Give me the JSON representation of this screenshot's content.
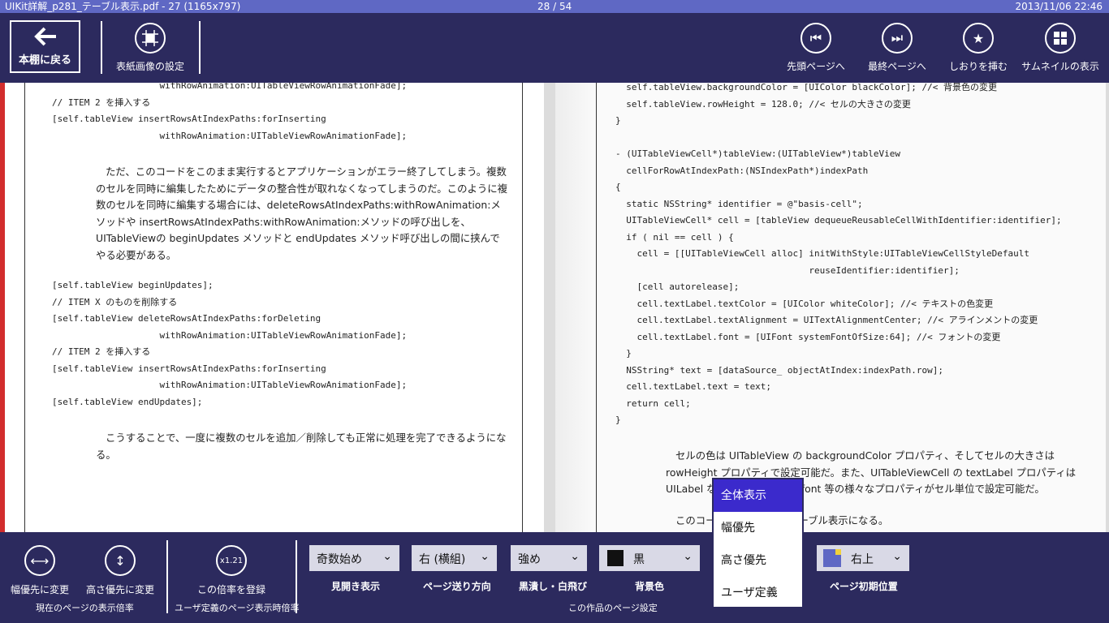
{
  "title_bar": {
    "file_title": "UIKit詳解_p281_テーブル表示.pdf - 27 (1165x797)",
    "page_counter": "28 / 54",
    "datetime": "2013/11/06 22:46"
  },
  "top_bar": {
    "back_label": "本棚に戻る",
    "cover_label": "表紙画像の設定",
    "first_page_label": "先頭ページへ",
    "last_page_label": "最終ページへ",
    "bookmark_label": "しおりを挿む",
    "thumbnail_label": "サムネイルの表示"
  },
  "left_page": {
    "code1": "                    withRowAnimation:UITableViewRowAnimationFade];\n// ITEM 2 を挿入する\n[self.tableView insertRowsAtIndexPaths:forInserting\n                    withRowAnimation:UITableViewRowAnimationFade];",
    "para1": "ただ、このコードをこのまま実行するとアプリケーションがエラー終了してしまう。複数のセルを同時に編集したためにデータの整合性が取れなくなってしまうのだ。このように複数のセルを同時に編集する場合には、deleteRowsAtIndexPaths:withRowAnimation:メソッドや insertRowsAtIndexPaths:withRowAnimation:メソッドの呼び出しを、UITableViewの beginUpdates メソッドと endUpdates メソッド呼び出しの間に挟んでやる必要がある。",
    "code2": "[self.tableView beginUpdates];\n// ITEM X のものを削除する\n[self.tableView deleteRowsAtIndexPaths:forDeleting\n                    withRowAnimation:UITableViewRowAnimationFade];\n// ITEM 2 を挿入する\n[self.tableView insertRowsAtIndexPaths:forInserting\n                    withRowAnimation:UITableViewRowAnimationFade];\n[self.tableView endUpdates];",
    "para2": "こうすることで、一度に複数のセルを追加／削除しても正常に処理を完了できるようになる。"
  },
  "right_page": {
    "code": "  self.tableView.backgroundColor = [UIColor blackColor]; //< 背景色の変更\n  self.tableView.rowHeight = 128.0; //< セルの大きさの変更\n}\n\n- (UITableViewCell*)tableView:(UITableView*)tableView\n  cellForRowAtIndexPath:(NSIndexPath*)indexPath\n{\n  static NSString* identifier = @\"basis-cell\";\n  UITableViewCell* cell = [tableView dequeueReusableCellWithIdentifier:identifier];\n  if ( nil == cell ) {\n    cell = [[UITableViewCell alloc] initWithStyle:UITableViewCellStyleDefault\n                                    reuseIdentifier:identifier];\n    [cell autorelease];\n    cell.textLabel.textColor = [UIColor whiteColor]; //< テキストの色変更\n    cell.textLabel.textAlignment = UITextAlignmentCenter; //< アラインメントの変更\n    cell.textLabel.font = [UIFont systemFontOfSize:64]; //< フォントの変更\n  }\n  NSString* text = [dataSource_ objectAtIndex:indexPath.row];\n  cell.textLabel.text = text;\n  return cell;\n}",
    "para1": "セルの色は UITableView の backgroundColor プロパティ、そしてセルの大きさは rowHeight プロパティで設定可能だ。また、UITableViewCell の textLabel プロパティは UILabel な                textAlignment、font 等の様々なプロパティがセル単位で設定可能だ。",
    "para2": "このコー               9.4-1 のようなテーブル表示になる。"
  },
  "bottom_bar": {
    "fit_width_label": "幅優先に変更",
    "fit_height_label": "高さ優先に変更",
    "current_zoom_group": "現在のページの表示倍率",
    "zoom_value": "x1.21",
    "register_zoom_label": "この倍率を登録",
    "user_zoom_group": "ユーザ定義のページ表示時倍率",
    "spread": {
      "value": "奇数始め",
      "label": "見開き表示"
    },
    "direction": {
      "value": "右 (横組)",
      "label": "ページ送り方向"
    },
    "black_white": {
      "value": "強め",
      "label": "黒潰し・白飛び"
    },
    "background": {
      "value": "黒",
      "label": "背景色"
    },
    "initial_pos": {
      "value": "右上",
      "label": "ページ初期位置"
    },
    "work_settings_group": "この作品のページ設定"
  },
  "zoom_menu": {
    "items": [
      "全体表示",
      "幅優先",
      "高さ優先",
      "ユーザ定義"
    ],
    "selected": "全体表示"
  }
}
